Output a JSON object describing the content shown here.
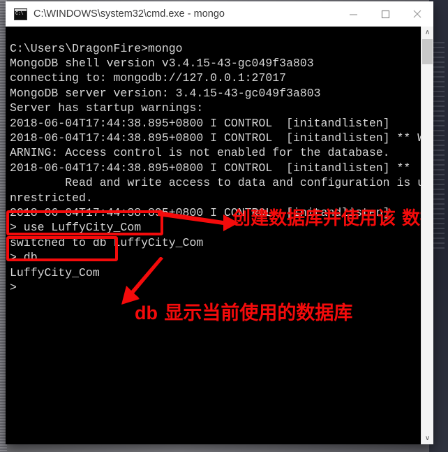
{
  "window": {
    "title": "C:\\WINDOWS\\system32\\cmd.exe - mongo",
    "icon_name": "cmd-console-icon",
    "icon_text": "C:\\",
    "controls": {
      "minimize_label": "Minimize",
      "maximize_label": "Maximize",
      "close_label": "Close"
    }
  },
  "console": {
    "background_color": "#000000",
    "text_color": "#d6d6d6",
    "lines": [
      "C:\\Users\\DragonFire>mongo",
      "MongoDB shell version v3.4.15-43-gc049f3a803",
      "connecting to: mongodb://127.0.0.1:27017",
      "MongoDB server version: 3.4.15-43-gc049f3a803",
      "Server has startup warnings:",
      "2018-06-04T17:44:38.895+0800 I CONTROL  [initandlisten]",
      "2018-06-04T17:44:38.895+0800 I CONTROL  [initandlisten] ** W",
      "ARNING: Access control is not enabled for the database.",
      "2018-06-04T17:44:38.895+0800 I CONTROL  [initandlisten] **",
      "        Read and write access to data and configuration is u",
      "nrestricted.",
      "2018-06-04T17:44:38.895+0800 I CONTROL  [initandlisten]",
      "> use LuffyCity_Com",
      "switched to db LuffyCity_Com",
      "> db",
      "LuffyCity_Com",
      ">"
    ],
    "text": "C:\\Users\\DragonFire>mongo\nMongoDB shell version v3.4.15-43-gc049f3a803\nconnecting to: mongodb://127.0.0.1:27017\nMongoDB server version: 3.4.15-43-gc049f3a803\nServer has startup warnings:\n2018-06-04T17:44:38.895+0800 I CONTROL  [initandlisten]\n2018-06-04T17:44:38.895+0800 I CONTROL  [initandlisten] ** W\nARNING: Access control is not enabled for the database.\n2018-06-04T17:44:38.895+0800 I CONTROL  [initandlisten] **\n        Read and write access to data and configuration is u\nnrestricted.\n2018-06-04T17:44:38.895+0800 I CONTROL  [initandlisten]\n> use LuffyCity_Com\nswitched to db LuffyCity_Com\n> db\nLuffyCity_Com\n>"
  },
  "scrollbar": {
    "up_arrow": "∧",
    "down_arrow": "∨"
  },
  "annotations": {
    "color": "#f40b0b",
    "top_text": "创建数据库并使用该\n数据库",
    "bottom_text_latin": "db",
    "bottom_text_cn": " 显示当前使用的数据库",
    "boxed_command_1": "> use LuffyCity_Com",
    "boxed_command_2": "> db"
  }
}
